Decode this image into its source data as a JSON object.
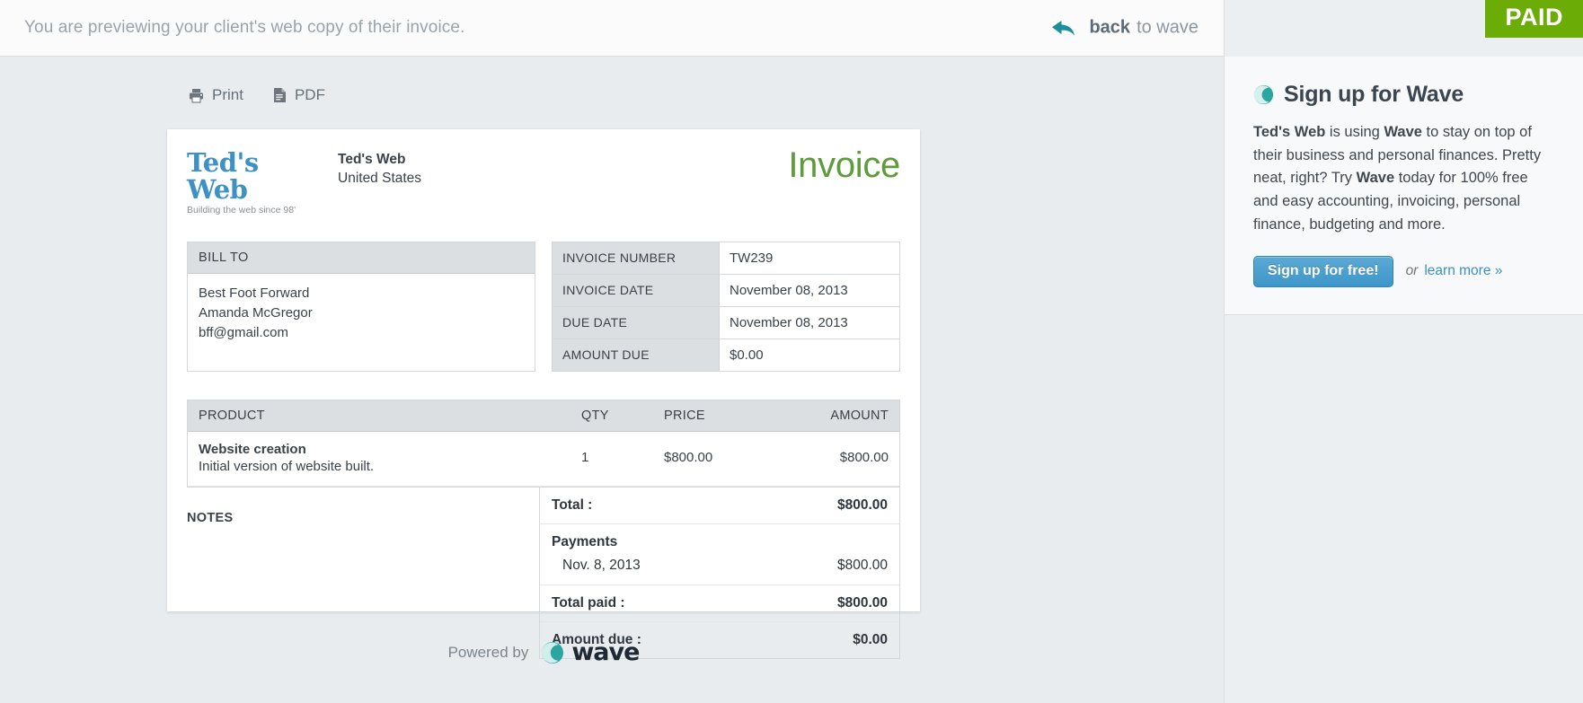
{
  "topbar": {
    "message": "You are previewing your client's web copy of their invoice.",
    "back_strong": "back",
    "back_rest": "to wave",
    "back_icon": "arrow-left-icon"
  },
  "promo": {
    "paid_badge": "PAID",
    "logo_icon": "wave-logo-icon",
    "title": "Sign up for Wave",
    "body_1": "Ted's Web",
    "body_2": " is using ",
    "body_3": "Wave",
    "body_4": " to stay on top of their business and personal finances. Pretty neat, right? Try ",
    "body_5": "Wave",
    "body_6": " today for 100% free and easy accounting, invoicing, personal finance, budgeting and more.",
    "signup_label": "Sign up for free!",
    "or_label": "or",
    "learn_more_label": "learn more »"
  },
  "toolbar": {
    "print_label": "Print",
    "print_icon": "printer-icon",
    "pdf_label": "PDF",
    "pdf_icon": "document-icon"
  },
  "invoice": {
    "logo_text": "Ted's Web",
    "logo_tagline": "Building the web since 98'",
    "business_name": "Ted's Web",
    "business_country": "United States",
    "heading": "Invoice",
    "bill_to": {
      "header": "BILL TO",
      "lines": [
        "Best Foot Forward",
        "Amanda McGregor",
        "bff@gmail.com"
      ]
    },
    "details": [
      {
        "key": "INVOICE NUMBER",
        "value": "TW239"
      },
      {
        "key": "INVOICE DATE",
        "value": "November 08, 2013"
      },
      {
        "key": "DUE DATE",
        "value": "November 08, 2013"
      },
      {
        "key": "AMOUNT DUE",
        "value": "$0.00"
      }
    ],
    "table": {
      "headers": {
        "product": "PRODUCT",
        "qty": "QTY",
        "price": "PRICE",
        "amount": "AMOUNT"
      },
      "rows": [
        {
          "name": "Website creation",
          "description": "Initial version of website built.",
          "qty": "1",
          "price": "$800.00",
          "amount": "$800.00"
        }
      ]
    },
    "notes_label": "NOTES",
    "totals": {
      "total_key": "Total :",
      "total_value": "$800.00",
      "payments_title": "Payments",
      "payment_date": "Nov. 8, 2013",
      "payment_amount": "$800.00",
      "total_paid_key": "Total paid :",
      "total_paid_value": "$800.00",
      "amount_due_key": "Amount due :",
      "amount_due_value": "$0.00"
    }
  },
  "footer": {
    "powered_text": "Powered by",
    "wave_word": "wave",
    "wave_icon": "wave-logo-icon"
  },
  "colors": {
    "paid_green": "#6cac07",
    "invoice_green": "#5d9b3c",
    "wave_teal": "#2aa5a0",
    "link_blue": "#3d8fc4",
    "logo_blue": "#3d91c4"
  }
}
